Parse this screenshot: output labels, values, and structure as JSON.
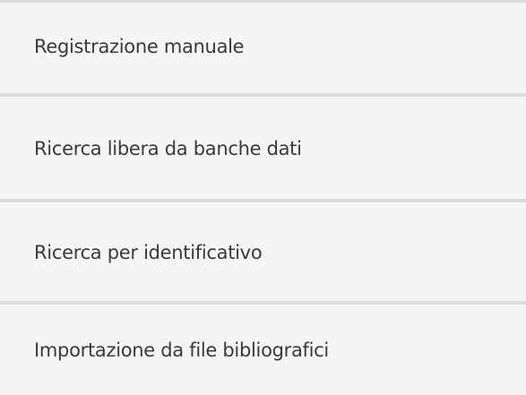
{
  "menu": {
    "items": [
      {
        "label": "Registrazione manuale"
      },
      {
        "label": "Ricerca libera da banche dati"
      },
      {
        "label": "Ricerca per identificativo"
      },
      {
        "label": "Importazione da file bibliografici"
      }
    ]
  }
}
